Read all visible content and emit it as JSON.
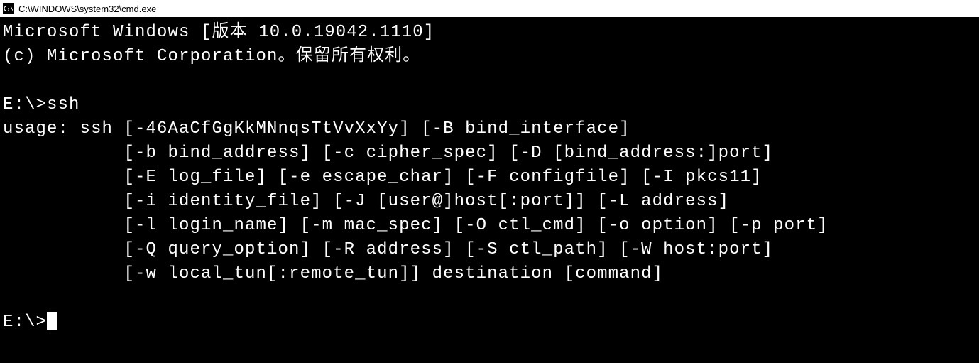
{
  "window": {
    "title": "C:\\WINDOWS\\system32\\cmd.exe",
    "icon_label": "C:\\"
  },
  "terminal": {
    "header1": "Microsoft Windows [版本 10.0.19042.1110]",
    "header2": "(c) Microsoft Corporation。保留所有权利。",
    "blank1": "",
    "prompt1": "E:\\>ssh",
    "usage1": "usage: ssh [-46AaCfGgKkMNnqsTtVvXxYy] [-B bind_interface]",
    "usage2": "           [-b bind_address] [-c cipher_spec] [-D [bind_address:]port]",
    "usage3": "           [-E log_file] [-e escape_char] [-F configfile] [-I pkcs11]",
    "usage4": "           [-i identity_file] [-J [user@]host[:port]] [-L address]",
    "usage5": "           [-l login_name] [-m mac_spec] [-O ctl_cmd] [-o option] [-p port]",
    "usage6": "           [-Q query_option] [-R address] [-S ctl_path] [-W host:port]",
    "usage7": "           [-w local_tun[:remote_tun]] destination [command]",
    "blank2": "",
    "prompt2": "E:\\>"
  }
}
